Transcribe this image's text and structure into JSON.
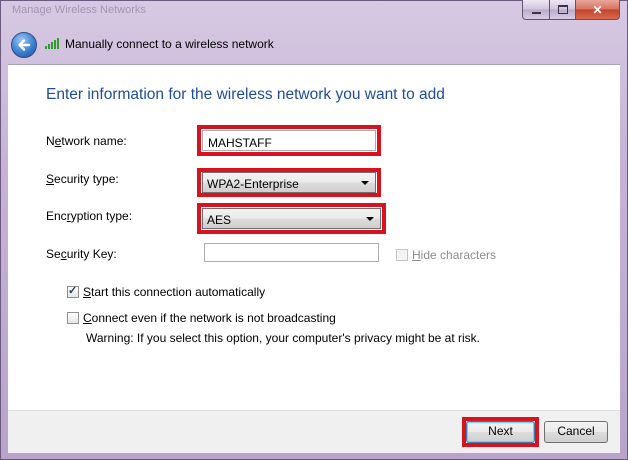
{
  "window": {
    "frame_title": "Manage Wireless Networks",
    "dialog_title": "Manually connect to a wireless network",
    "controls": {
      "minimize": "minimize",
      "maximize": "maximize",
      "close": "close"
    }
  },
  "instruction": "Enter information for the wireless network you want to add",
  "fields": {
    "network_name": {
      "label_pre": "N",
      "label_key": "e",
      "label_post": "twork name:",
      "value": "MAHSTAFF"
    },
    "security_type": {
      "label_pre": "",
      "label_key": "S",
      "label_post": "ecurity type:",
      "value": "WPA2-Enterprise"
    },
    "encryption_type": {
      "label_pre": "Enc",
      "label_key": "r",
      "label_post": "yption type:",
      "value": "AES"
    },
    "security_key": {
      "label_pre": "Se",
      "label_key": "c",
      "label_post": "urity Key:",
      "value": ""
    }
  },
  "hide_characters": {
    "key": "H",
    "rest": "ide characters",
    "checked": false,
    "enabled": false
  },
  "start_automatically": {
    "key": "S",
    "rest": "tart this connection automatically",
    "checked": true
  },
  "connect_even": {
    "key": "C",
    "rest": "onnect even if the network is not broadcasting",
    "checked": false
  },
  "warning": "Warning: If you select this option, your computer's privacy might be at risk.",
  "buttons": {
    "next": "Next",
    "cancel": "Cancel"
  },
  "colors": {
    "highlight": "#d8131f",
    "instruction_text": "#1e4e97"
  }
}
